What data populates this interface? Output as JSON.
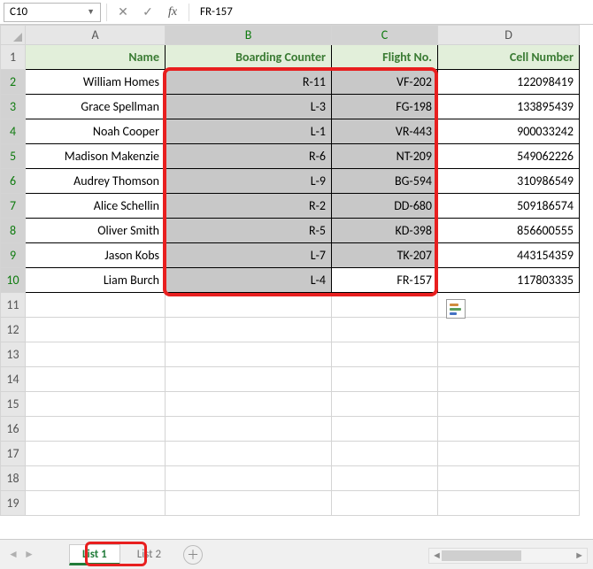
{
  "namebox": {
    "value": "C10"
  },
  "formula_bar": {
    "value": "FR-157",
    "fx_label": "fx"
  },
  "columns": [
    "A",
    "B",
    "C",
    "D"
  ],
  "headers": {
    "A": "Name",
    "B": "Boarding Counter",
    "C": "Flight No.",
    "D": "Cell Number"
  },
  "rows": [
    {
      "n": "2",
      "A": "William Homes",
      "B": "R-11",
      "C": "VF-202",
      "D": "122098419"
    },
    {
      "n": "3",
      "A": "Grace Spellman",
      "B": "L-3",
      "C": "FG-198",
      "D": "133895439"
    },
    {
      "n": "4",
      "A": "Noah Cooper",
      "B": "L-1",
      "C": "VR-443",
      "D": "900033242"
    },
    {
      "n": "5",
      "A": "Madison Makenzie",
      "B": "R-6",
      "C": "NT-209",
      "D": "549062226"
    },
    {
      "n": "6",
      "A": "Audrey Thomson",
      "B": "L-9",
      "C": "BG-594",
      "D": "310986549"
    },
    {
      "n": "7",
      "A": "Alice Schellin",
      "B": "R-2",
      "C": "DD-680",
      "D": "509186574"
    },
    {
      "n": "8",
      "A": "Oliver Smith",
      "B": "R-5",
      "C": "KD-398",
      "D": "856600555"
    },
    {
      "n": "9",
      "A": "Jason Kobs",
      "B": "L-7",
      "C": "TK-207",
      "D": "443154359"
    },
    {
      "n": "10",
      "A": "Liam Burch",
      "B": "L-4",
      "C": "FR-157",
      "D": "117803335"
    }
  ],
  "empty_rows": [
    "11",
    "12",
    "13",
    "14",
    "15",
    "16",
    "17",
    "18",
    "19"
  ],
  "tabs": {
    "active": "List 1",
    "other": "List 2"
  },
  "selection": {
    "range": "B2:C10",
    "active": "C10"
  },
  "chart_data": null
}
